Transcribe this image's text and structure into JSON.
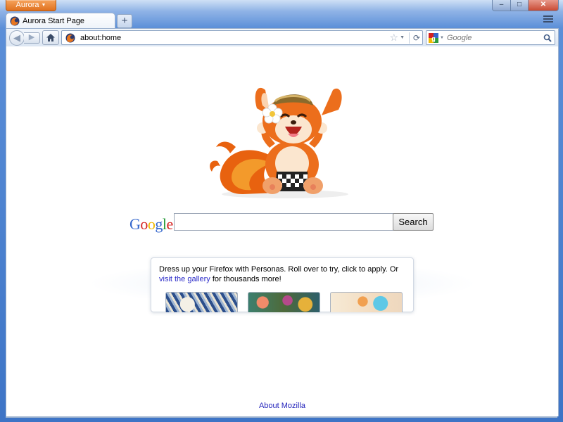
{
  "window": {
    "app_button_label": "Aurora",
    "minimize_label": "–",
    "maximize_label": "□",
    "close_label": "✕"
  },
  "tabs": [
    {
      "title": "Aurora Start Page",
      "favicon": "aurora-icon",
      "selected": true
    }
  ],
  "tabbar": {
    "new_tab_label": "+"
  },
  "navbar": {
    "url": "about:home",
    "search_engine": "google-icon",
    "search_placeholder": "Google",
    "reload_label": "⟳"
  },
  "content": {
    "google_logo": [
      "G",
      "o",
      "o",
      "g",
      "l",
      "e"
    ],
    "google_logo_colors": [
      "#3366cc",
      "#d42020",
      "#efb800",
      "#3366cc",
      "#2a9b3d",
      "#d42020"
    ],
    "search_value": "",
    "search_button_label": "Search",
    "snippet": {
      "text_before": "Dress up your Firefox with Personas. Roll over to try, click to apply. Or ",
      "link_text": "visit the gallery",
      "text_after": " for thousands more!"
    },
    "about_link": "About Mozilla"
  },
  "colors": {
    "accent_orange": "#e0711f",
    "link": "#2a2ac8",
    "frame_blue": "#3d74c6"
  }
}
